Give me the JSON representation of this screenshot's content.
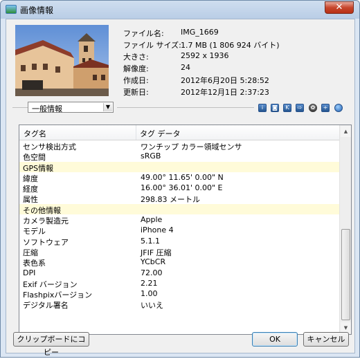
{
  "window": {
    "title": "画像情報",
    "close_glyph": "✕"
  },
  "file_info": [
    {
      "label": "ファイル名:",
      "value": "IMG_1669"
    },
    {
      "label": "ファイル サイズ:",
      "value": "1.7 MB (1 806 924 バイト)"
    },
    {
      "label": "大きさ:",
      "value": "2592 x 1936"
    },
    {
      "label": "解像度:",
      "value": "24"
    },
    {
      "label": "作成日:",
      "value": "2012年6月20日 5:28:52"
    },
    {
      "label": "更新日:",
      "value": "2012年12月1日 2:37:23"
    }
  ],
  "category_select": {
    "selected": "一般情報"
  },
  "toolbar_icons": [
    "info-icon",
    "camera-icon",
    "k-icon",
    "export-icon",
    "gear-icon",
    "map-add-icon",
    "globe-icon"
  ],
  "table": {
    "columns": [
      "タグ名",
      "タグ データ"
    ],
    "rows": [
      {
        "name": "センサ検出方式",
        "value": "ワンチップ カラー領域センサ",
        "group": false
      },
      {
        "name": "色空間",
        "value": "sRGB",
        "group": false
      },
      {
        "name": "GPS情報",
        "value": "",
        "group": true
      },
      {
        "name": "緯度",
        "value": "49.00° 11.65' 0.00\" N",
        "group": false
      },
      {
        "name": "経度",
        "value": "16.00° 36.01' 0.00\" E",
        "group": false
      },
      {
        "name": "属性",
        "value": "298.83 メートル",
        "group": false
      },
      {
        "name": "その他情報",
        "value": "",
        "group": true
      },
      {
        "name": "カメラ製造元",
        "value": "Apple",
        "group": false
      },
      {
        "name": "モデル",
        "value": "iPhone 4",
        "group": false
      },
      {
        "name": "ソフトウェア",
        "value": "5.1.1",
        "group": false
      },
      {
        "name": "圧縮",
        "value": "JFIF 圧縮",
        "group": false
      },
      {
        "name": "表色系",
        "value": "YCbCR",
        "group": false
      },
      {
        "name": "DPI",
        "value": "72.00",
        "group": false
      },
      {
        "name": "Exif バージョン",
        "value": "2.21",
        "group": false
      },
      {
        "name": "Flashpixバージョン",
        "value": "1.00",
        "group": false
      },
      {
        "name": "デジタル署名",
        "value": "いいえ",
        "group": false
      }
    ]
  },
  "buttons": {
    "copy": "クリップボードにコピー",
    "ok": "OK",
    "cancel": "キャンセル"
  }
}
